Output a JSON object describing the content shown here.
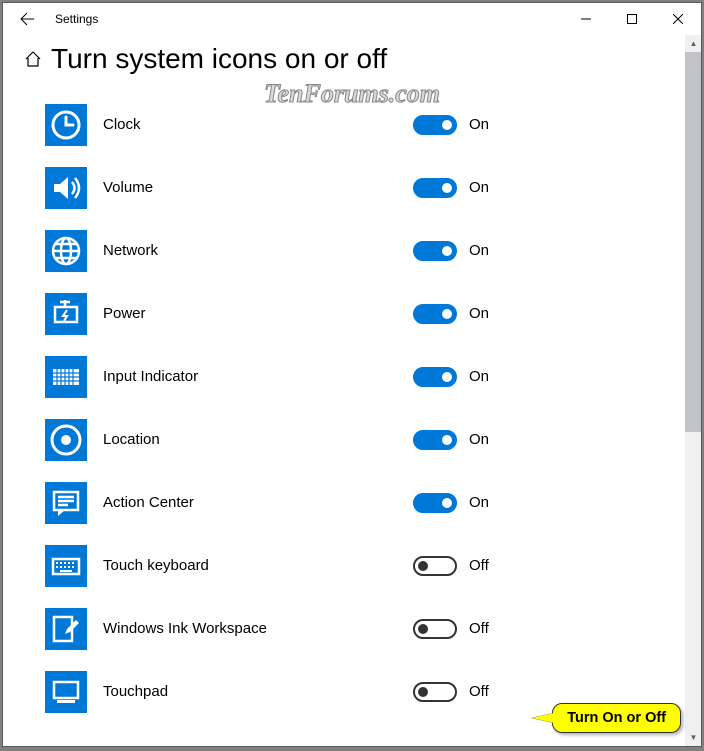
{
  "app_title": "Settings",
  "page_title": "Turn system icons on or off",
  "watermark": "TenForums.com",
  "labels": {
    "on": "On",
    "off": "Off"
  },
  "callout": "Turn On or Off",
  "items": [
    {
      "key": "clock",
      "label": "Clock",
      "on": true
    },
    {
      "key": "volume",
      "label": "Volume",
      "on": true
    },
    {
      "key": "network",
      "label": "Network",
      "on": true
    },
    {
      "key": "power",
      "label": "Power",
      "on": true
    },
    {
      "key": "input-indicator",
      "label": "Input Indicator",
      "on": true
    },
    {
      "key": "location",
      "label": "Location",
      "on": true
    },
    {
      "key": "action-center",
      "label": "Action Center",
      "on": true
    },
    {
      "key": "touch-keyboard",
      "label": "Touch keyboard",
      "on": false
    },
    {
      "key": "windows-ink",
      "label": "Windows Ink Workspace",
      "on": false
    },
    {
      "key": "touchpad",
      "label": "Touchpad",
      "on": false
    }
  ]
}
